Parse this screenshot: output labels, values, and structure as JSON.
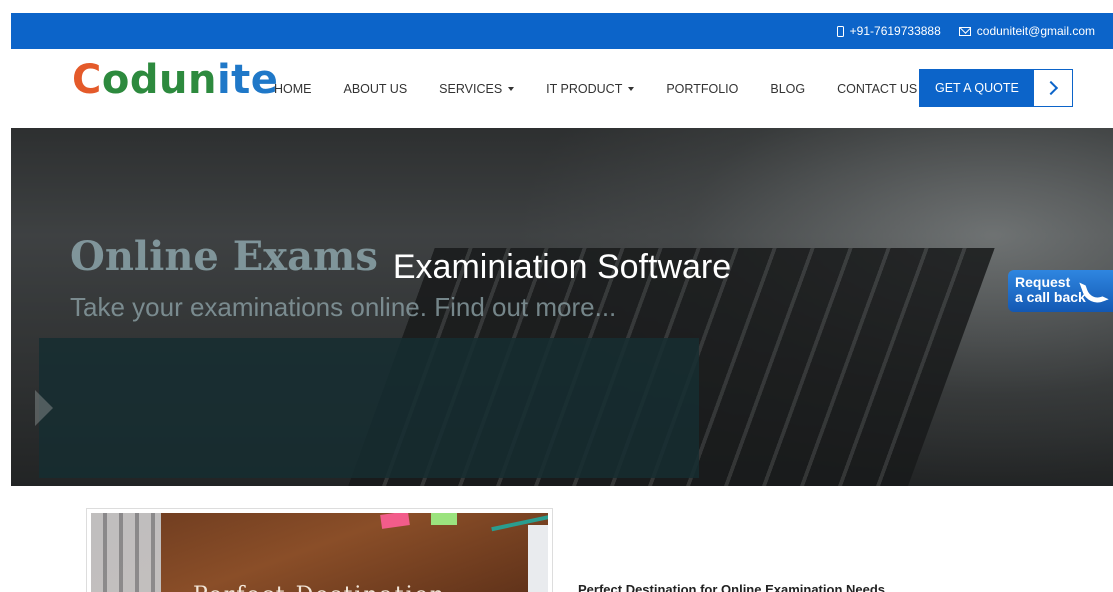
{
  "topbar": {
    "phone": "+91-7619733888",
    "email": "coduniteit@gmail.com"
  },
  "logo": {
    "part1": "C",
    "part2": "odun",
    "part3": "ite"
  },
  "nav": {
    "items": [
      {
        "label": "HOME"
      },
      {
        "label": "ABOUT US"
      },
      {
        "label": "SERVICES"
      },
      {
        "label": "IT PRODUCT"
      },
      {
        "label": "PORTFOLIO"
      },
      {
        "label": "BLOG"
      },
      {
        "label": "CONTACT US"
      }
    ],
    "quote_label": "GET A QUOTE"
  },
  "hero": {
    "title": "Examiniation Software",
    "banner_title": "Online Exams",
    "banner_sub": "Take your examinations online. Find out more..."
  },
  "callback": {
    "line1": "Request",
    "line2": "a call back"
  },
  "content": {
    "image_caption": "Perfect Destination",
    "section_title": "Perfect Destination for Online Examination Needs"
  },
  "colors": {
    "brand_blue": "#0c64c9",
    "logo_orange": "#e45a2a",
    "logo_green": "#2d8a3e",
    "logo_blue": "#1f78c8"
  }
}
